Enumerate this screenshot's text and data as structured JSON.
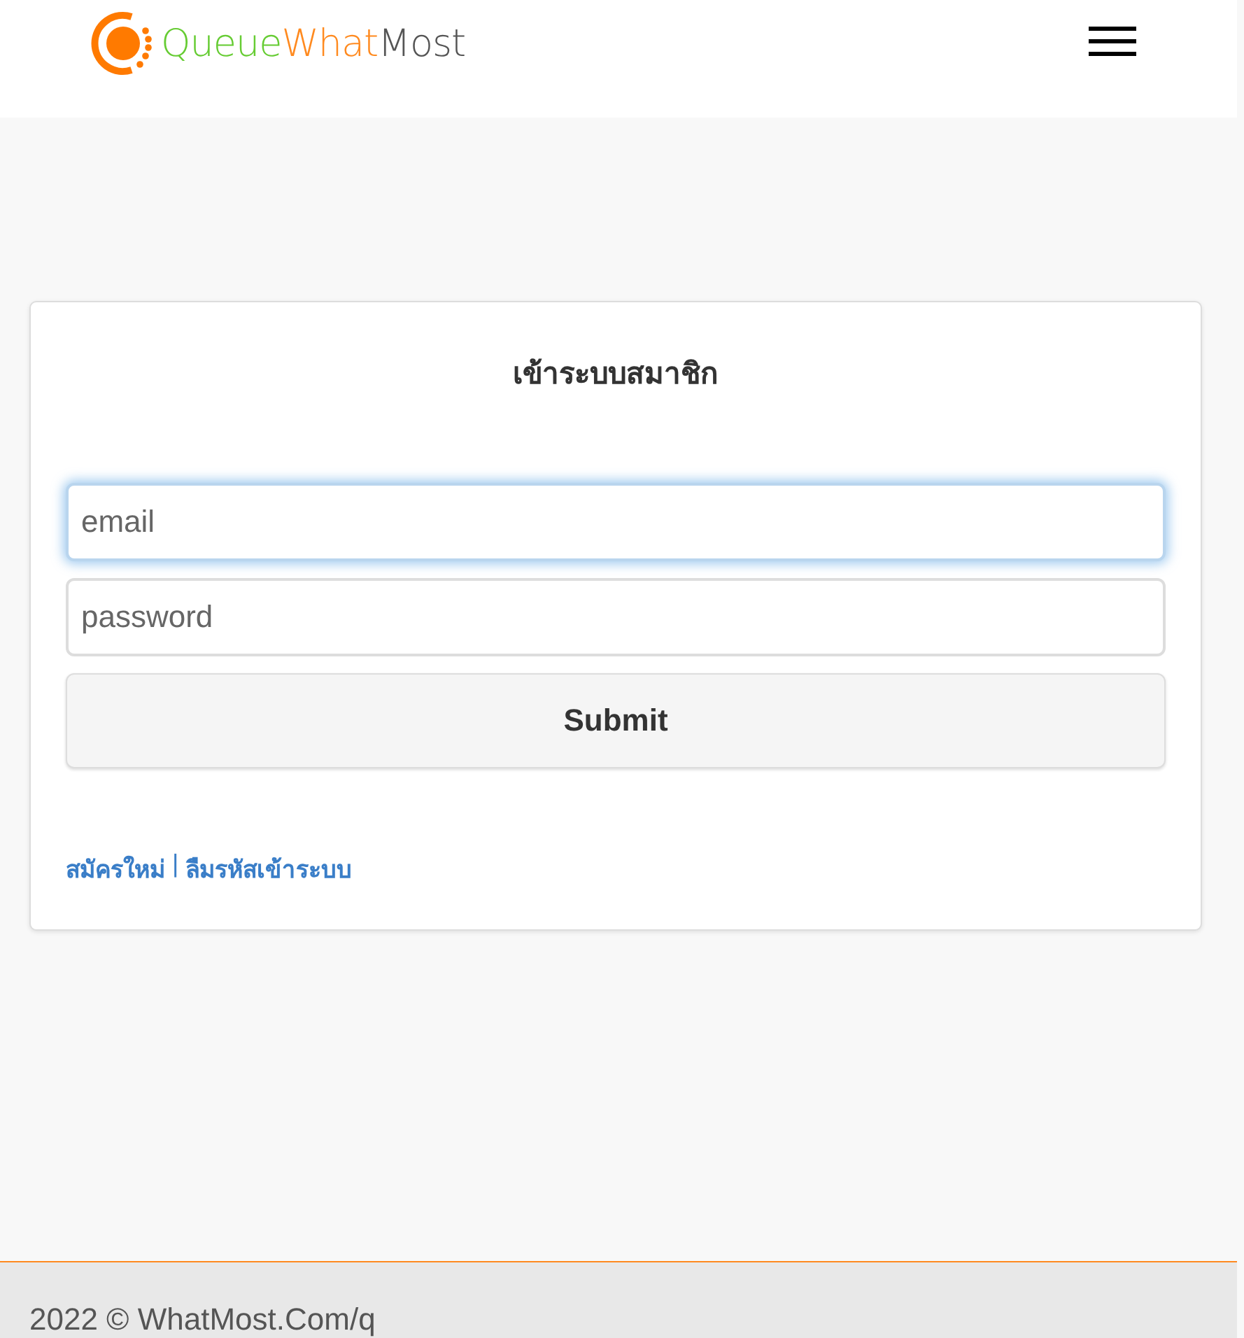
{
  "header": {
    "logo": [
      {
        "text": "Queue",
        "color": "#66cc33"
      },
      {
        "text": "What",
        "color": "#ff8a1f"
      },
      {
        "text": "Most",
        "color": "#555555"
      }
    ]
  },
  "login": {
    "title": "เข้าระบบสมาชิก",
    "fields": [
      {
        "placeholder": "email",
        "focused": true
      },
      {
        "placeholder": "password",
        "focused": false
      }
    ],
    "submit": "Submit",
    "links": [
      "สมัครใหม่",
      "ลืมรหัสเข้าระบบ"
    ],
    "separator": "|"
  },
  "footer": {
    "text": "2022 © WhatMost.Com/q"
  }
}
